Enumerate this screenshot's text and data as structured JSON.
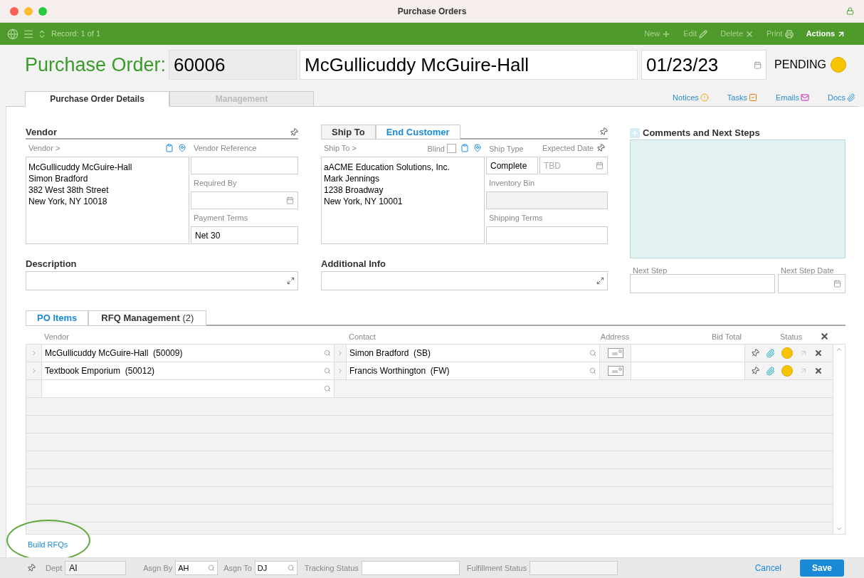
{
  "window": {
    "title": "Purchase Orders"
  },
  "toolbar": {
    "record": "Record: 1 of 1",
    "actions": [
      {
        "label": "New",
        "kind": "new",
        "disabled": true
      },
      {
        "label": "Edit",
        "kind": "edit",
        "disabled": true
      },
      {
        "label": "Delete",
        "kind": "delete",
        "disabled": true
      },
      {
        "label": "Print",
        "kind": "print",
        "disabled": true
      },
      {
        "label": "Actions",
        "kind": "actions",
        "disabled": false
      }
    ]
  },
  "header": {
    "label": "Purchase Order:",
    "number": "60006",
    "vendor_name": "McGullicuddy McGuire-Hall",
    "date": "01/23/23",
    "status": "PENDING"
  },
  "tabs": [
    {
      "label": "Purchase Order Details",
      "selected": true
    },
    {
      "label": "Management",
      "selected": false
    }
  ],
  "links": [
    {
      "label": "Notices",
      "kind": "notices"
    },
    {
      "label": "Tasks",
      "kind": "tasks"
    },
    {
      "label": "Emails",
      "kind": "emails"
    },
    {
      "label": "Docs",
      "kind": "docs"
    }
  ],
  "vendor": {
    "title": "Vendor",
    "address_label": "Vendor >",
    "address": [
      "McGullicuddy McGuire-Hall",
      "Simon Bradford",
      "382 West 38th Street",
      "New York, NY 10018"
    ],
    "vendor_reference": "Vendor Reference",
    "required_by": "Required By",
    "payment_terms": {
      "label": "Payment Terms",
      "value": "Net 30"
    }
  },
  "ship": {
    "tabs": [
      {
        "label": "Ship To",
        "selected": true
      },
      {
        "label": "End Customer",
        "selected": false
      }
    ],
    "address_label": "Ship To >",
    "blind": {
      "label": "Blind",
      "checked": false
    },
    "address": [
      "aACME Education Solutions, Inc.",
      "Mark Jennings",
      "1238 Broadway",
      "New York, NY 10001"
    ],
    "ship_type": {
      "label": "Ship Type",
      "value": "Complete"
    },
    "expected_date": {
      "label": "Expected Date",
      "placeholder": "TBD"
    },
    "inventory_bin": {
      "label": "Inventory Bin",
      "disabled": true
    },
    "shipping_terms": "Shipping Terms"
  },
  "comments": {
    "title": "Comments and Next Steps",
    "next_step": "Next Step",
    "next_step_date": "Next Step Date"
  },
  "description": "Description",
  "additional_info": "Additional Info",
  "rfq": {
    "tabs": [
      {
        "label": "PO Items",
        "selected": false
      },
      {
        "label": "RFQ Management",
        "count": "(2)",
        "selected": true
      }
    ],
    "columns": [
      "Vendor",
      "Contact",
      "Address",
      "Bid Total",
      "Status"
    ],
    "rows": [
      {
        "vendor": "McGullicuddy McGuire-Hall  (50009)",
        "contact": "Simon Bradford  (SB)"
      },
      {
        "vendor": "Textbook Emporium  (50012)",
        "contact": "Francis Worthington  (FW)"
      }
    ],
    "link": "Build RFQs"
  },
  "footer": {
    "dept": {
      "label": "Dept",
      "value": "AI"
    },
    "asgn_by": {
      "label": "Asgn By",
      "value": "AH"
    },
    "asgn_to": {
      "label": "Asgn To",
      "value": "DJ"
    },
    "tracking_status": "Tracking Status",
    "fulfillment_status": "Fulfillment Status",
    "cancel": "Cancel",
    "save": "Save"
  }
}
